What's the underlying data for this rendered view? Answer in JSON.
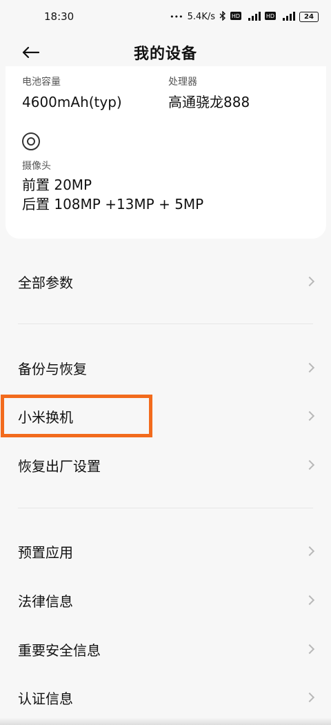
{
  "status_bar": {
    "time": "18:30",
    "speed": "5.4K/s",
    "battery": "24",
    "icons": [
      "dots-icon",
      "bluetooth-icon",
      "hd-icon",
      "signal-5g-icon",
      "hd-icon",
      "signal-4g-icon",
      "battery-icon"
    ]
  },
  "header": {
    "title": "我的设备",
    "back_icon": "back-arrow-icon"
  },
  "specs": {
    "battery": {
      "label": "电池容量",
      "value": "4600mAh(typ)"
    },
    "processor": {
      "label": "处理器",
      "value": "高通骁龙888"
    },
    "camera": {
      "icon": "camera-icon",
      "label": "摄像头",
      "front": "前置 20MP",
      "rear": "后置 108MP +13MP + 5MP"
    }
  },
  "menu": {
    "all_params": "全部参数",
    "backup_restore": "备份与恢复",
    "mi_mover": "小米换机",
    "factory_reset": "恢复出厂设置",
    "preinstalled_apps": "预置应用",
    "legal_info": "法律信息",
    "safety_info": "重要安全信息",
    "certification": "认证信息"
  },
  "colors": {
    "background": "#f7f7f7",
    "card": "#ffffff",
    "highlight": "#f26b1d",
    "chevron": "#b8b8b8"
  }
}
